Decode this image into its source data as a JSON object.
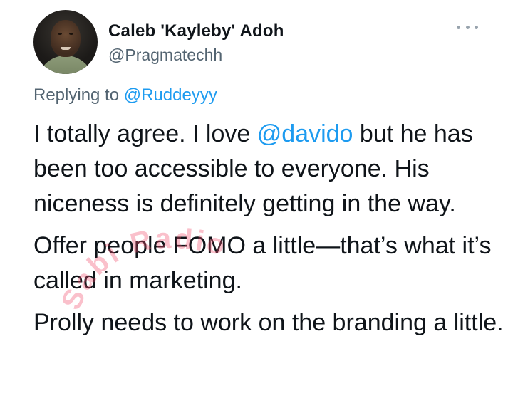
{
  "author": {
    "display_name": "Caleb 'Kayleby' Adoh",
    "handle": "@Pragmatechh"
  },
  "more_icon": "ellipsis-icon",
  "reply": {
    "prefix": "Replying to ",
    "mention": "@Ruddeyyy"
  },
  "tweet": {
    "p1_before": "I totally agree. I love ",
    "p1_mention": "@davido",
    "p1_after": " but he has been too accessible to everyone. His niceness is definitely getting in the way.",
    "p2": "Offer people FOMO a little—that’s what it’s called in marketing.",
    "p3": "Prolly needs to work on the branding a little."
  },
  "watermark": {
    "text": "Sabi Radio",
    "color": "#f24b6a"
  },
  "colors": {
    "text": "#0f1419",
    "secondary": "#536471",
    "link": "#1d9bf0"
  }
}
